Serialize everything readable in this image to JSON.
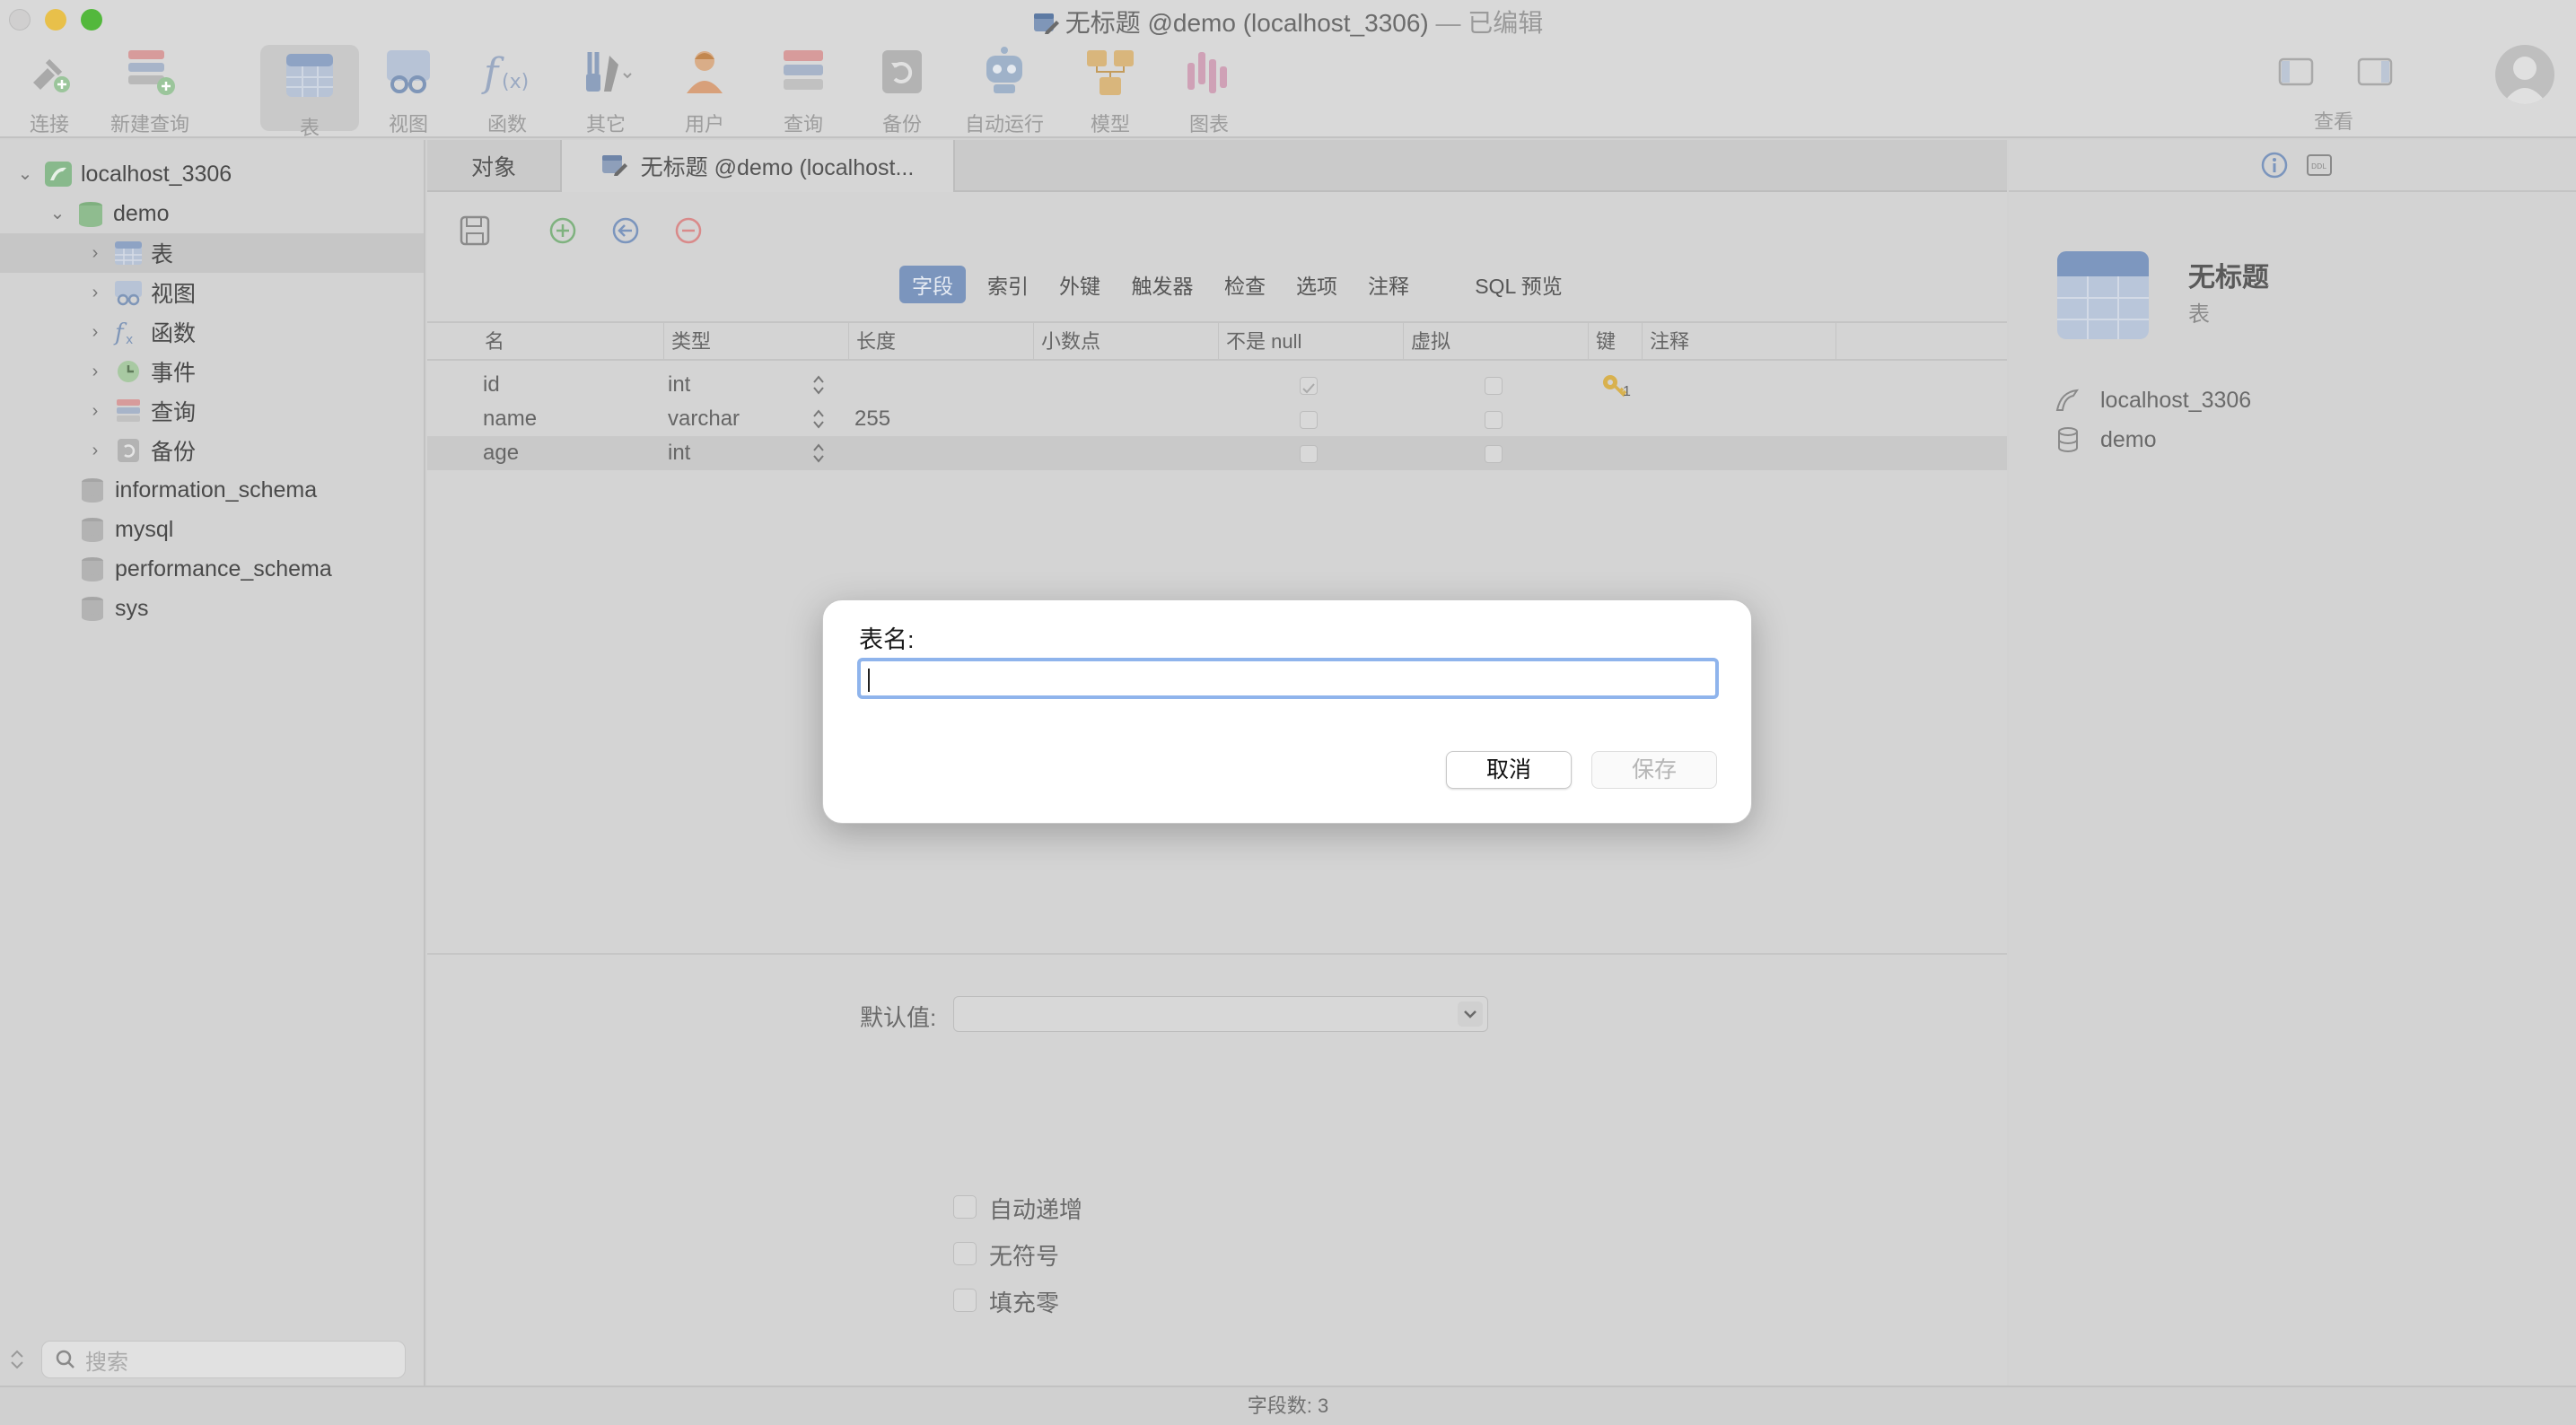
{
  "window": {
    "title": "无标题 @demo (localhost_3306)",
    "title_suffix": "— 已编辑"
  },
  "toolbar": {
    "items": [
      {
        "label": "连接",
        "icon": "connect-icon"
      },
      {
        "label": "新建查询",
        "icon": "new-query-icon"
      },
      {
        "label": "表",
        "icon": "table-icon",
        "active": true
      },
      {
        "label": "视图",
        "icon": "view-icon"
      },
      {
        "label": "函数",
        "icon": "function-icon"
      },
      {
        "label": "其它",
        "icon": "tools-icon"
      },
      {
        "label": "用户",
        "icon": "user-icon"
      },
      {
        "label": "查询",
        "icon": "query-icon"
      },
      {
        "label": "备份",
        "icon": "backup-icon"
      },
      {
        "label": "自动运行",
        "icon": "robot-icon"
      },
      {
        "label": "模型",
        "icon": "model-icon"
      },
      {
        "label": "图表",
        "icon": "chart-icon"
      }
    ],
    "view_label": "查看"
  },
  "sidebar": {
    "connection": "localhost_3306",
    "database": "demo",
    "children": [
      "表",
      "视图",
      "函数",
      "事件",
      "查询",
      "备份"
    ],
    "other_databases": [
      "information_schema",
      "mysql",
      "performance_schema",
      "sys"
    ],
    "search_placeholder": "搜索"
  },
  "editor": {
    "tabs": [
      "对象",
      "无标题 @demo (localhost..."
    ],
    "segments": [
      "字段",
      "索引",
      "外键",
      "触发器",
      "检查",
      "选项",
      "注释",
      "SQL 预览"
    ],
    "active_segment": "字段",
    "columns": [
      "名",
      "类型",
      "长度",
      "小数点",
      "不是 null",
      "虚拟",
      "键",
      "注释"
    ],
    "rows": [
      {
        "name": "id",
        "type": "int",
        "length": "",
        "not_null": true,
        "key": "1"
      },
      {
        "name": "name",
        "type": "varchar",
        "length": "255",
        "not_null": false,
        "key": ""
      },
      {
        "name": "age",
        "type": "int",
        "length": "",
        "not_null": false,
        "key": ""
      }
    ],
    "props": {
      "default_label": "默认值:",
      "auto_increment": "自动递增",
      "unsigned": "无符号",
      "zerofill": "填充零"
    }
  },
  "right_panel": {
    "title": "无标题",
    "subtitle": "表",
    "connection": "localhost_3306",
    "database": "demo"
  },
  "status": {
    "field_count": "字段数: 3"
  },
  "dialog": {
    "label": "表名:",
    "value": "",
    "cancel": "取消",
    "save": "保存"
  },
  "colors": {
    "accent": "#7b95bd",
    "input_focus": "#8fb4ec",
    "traffic_min": "#e8c04a",
    "traffic_max": "#53b83c"
  }
}
